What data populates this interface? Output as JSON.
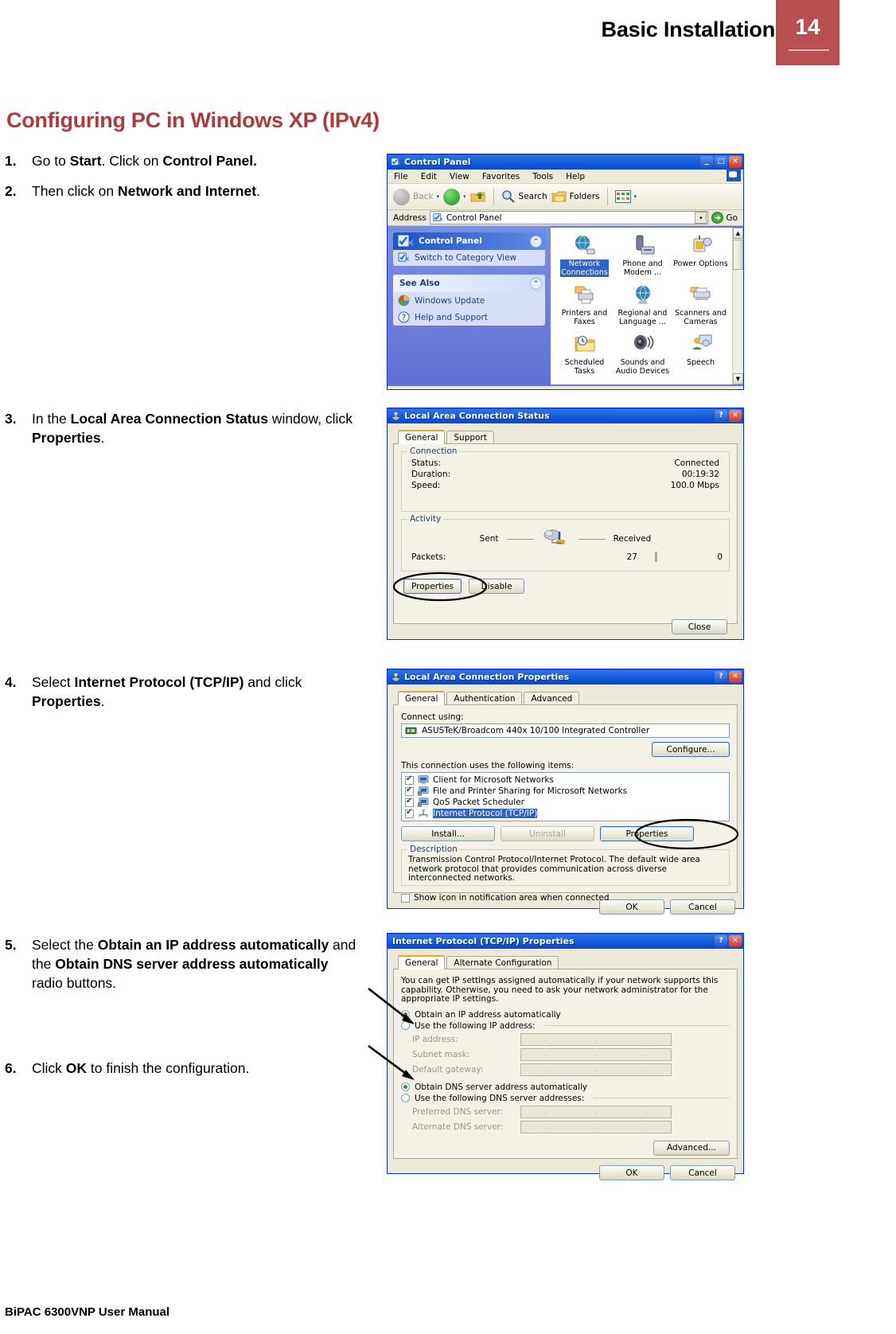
{
  "header": {
    "title": "Basic Installation",
    "page_number": "14",
    "accent_color": "#b8504f"
  },
  "section": {
    "heading": "Configuring PC in Windows XP (IPv4)",
    "heading_color": "#b03a3a"
  },
  "steps": [
    {
      "num": "1.",
      "html": "Go to <b>Start</b>. Click on <b>Control Panel.</b>"
    },
    {
      "num": "2.",
      "html": "Then click on <b>Network and Internet</b>."
    },
    {
      "num": "3.",
      "html": "In the <b>Local Area Connection Status</b> window, click <b>Properties</b>."
    },
    {
      "num": "4.",
      "html": "Select <b>Internet Protocol (TCP/IP)</b> and click <b>Properties</b>."
    },
    {
      "num": "5.",
      "html": "Select the <b>Obtain an IP address automatically</b> and the <b>Obtain DNS server address automatically</b> radio buttons."
    },
    {
      "num": "6.",
      "html": "Click <b>OK</b> to finish the configuration."
    }
  ],
  "footer": {
    "text": "BiPAC 6300VNP User Manual"
  },
  "control_panel": {
    "title": "Control Panel",
    "title_icon": "control-panel-icon",
    "window_buttons": {
      "minimize": "_",
      "maximize": "□",
      "close": "✕"
    },
    "menus": [
      "File",
      "Edit",
      "View",
      "Favorites",
      "Tools",
      "Help"
    ],
    "toolbar": {
      "back": "Back",
      "forward": "",
      "up": "",
      "search": "Search",
      "folders": "Folders",
      "views": ""
    },
    "address": {
      "label": "Address",
      "value": "Control Panel",
      "go": "Go"
    },
    "sidebar": {
      "panel1": {
        "title": "Control Panel",
        "items": [
          {
            "label": "Switch to Category View",
            "icon": "control-panel-icon"
          }
        ]
      },
      "panel2": {
        "title": "See Also",
        "items": [
          {
            "label": "Windows Update",
            "icon": "windows-update-icon"
          },
          {
            "label": "Help and Support",
            "icon": "help-icon"
          }
        ]
      }
    },
    "icons": [
      {
        "label": "Network\nConnections",
        "icon": "network-connections-icon",
        "selected": true
      },
      {
        "label": "Phone and\nModem ...",
        "icon": "phone-modem-icon",
        "selected": false
      },
      {
        "label": "Power Options",
        "icon": "power-options-icon",
        "selected": false
      },
      {
        "label": "Printers and\nFaxes",
        "icon": "printers-faxes-icon",
        "selected": false
      },
      {
        "label": "Regional and\nLanguage ...",
        "icon": "regional-language-icon",
        "selected": false
      },
      {
        "label": "Scanners and\nCameras",
        "icon": "scanners-cameras-icon",
        "selected": false
      },
      {
        "label": "Scheduled\nTasks",
        "icon": "scheduled-tasks-icon",
        "selected": false
      },
      {
        "label": "Sounds and\nAudio Devices",
        "icon": "sounds-audio-icon",
        "selected": false
      },
      {
        "label": "Speech",
        "icon": "speech-icon",
        "selected": false
      }
    ]
  },
  "lac_status": {
    "title": "Local Area Connection Status",
    "title_icon": "network-plug-icon",
    "window_buttons": {
      "help": "?",
      "close": "✕"
    },
    "tabs": [
      {
        "label": "General",
        "active": true
      },
      {
        "label": "Support",
        "active": false
      }
    ],
    "connection": {
      "legend": "Connection",
      "rows": [
        {
          "label": "Status:",
          "value": "Connected"
        },
        {
          "label": "Duration:",
          "value": "00:19:32"
        },
        {
          "label": "Speed:",
          "value": "100.0 Mbps"
        }
      ]
    },
    "activity": {
      "legend": "Activity",
      "sent_label": "Sent",
      "received_label": "Received",
      "packets_label": "Packets:",
      "packets_sent": "27",
      "packets_received": "0"
    },
    "buttons": {
      "properties": "Properties",
      "disable": "Disable",
      "close": "Close"
    },
    "annotation": "ellipse-around-properties"
  },
  "lac_properties": {
    "title": "Local Area Connection Properties",
    "title_icon": "network-plug-icon",
    "window_buttons": {
      "help": "?",
      "close": "✕"
    },
    "tabs": [
      {
        "label": "General",
        "active": true
      },
      {
        "label": "Authentication",
        "active": false
      },
      {
        "label": "Advanced",
        "active": false
      }
    ],
    "connect_using_label": "Connect using:",
    "adapter": "ASUSTeK/Broadcom 440x 10/100 Integrated Controller",
    "adapter_icon": "nic-card-icon",
    "configure_button": "Configure...",
    "items_label": "This connection uses the following items:",
    "items": [
      {
        "label": "Client for Microsoft Networks",
        "checked": true,
        "selected": false
      },
      {
        "label": "File and Printer Sharing for Microsoft Networks",
        "checked": true,
        "selected": false
      },
      {
        "label": "QoS Packet Scheduler",
        "checked": true,
        "selected": false
      },
      {
        "label": "Internet Protocol (TCP/IP)",
        "checked": true,
        "selected": true
      }
    ],
    "buttons": {
      "install": "Install...",
      "uninstall": "Uninstall",
      "properties": "Properties",
      "ok": "OK",
      "cancel": "Cancel"
    },
    "description": {
      "legend": "Description",
      "text": "Transmission Control Protocol/Internet Protocol. The default wide area network protocol that provides communication across diverse interconnected networks."
    },
    "show_icon_checkbox": {
      "label": "Show icon in notification area when connected",
      "checked": false
    },
    "annotation": "ellipse-around-properties"
  },
  "tcpip_properties": {
    "title": "Internet Protocol (TCP/IP) Properties",
    "window_buttons": {
      "help": "?",
      "close": "✕"
    },
    "tabs": [
      {
        "label": "General",
        "active": true
      },
      {
        "label": "Alternate Configuration",
        "active": false
      }
    ],
    "intro": "You can get IP settings assigned automatically if your network supports this capability. Otherwise, you need to ask your network administrator for the appropriate IP settings.",
    "ip_options": [
      {
        "label": "Obtain an IP address automatically",
        "selected": true
      },
      {
        "label": "Use the following IP address:",
        "selected": false
      }
    ],
    "ip_fields": [
      {
        "label": "IP address:",
        "value": ""
      },
      {
        "label": "Subnet mask:",
        "value": ""
      },
      {
        "label": "Default gateway:",
        "value": ""
      }
    ],
    "dns_options": [
      {
        "label": "Obtain DNS server address automatically",
        "selected": true
      },
      {
        "label": "Use the following DNS server addresses:",
        "selected": false
      }
    ],
    "dns_fields": [
      {
        "label": "Preferred DNS server:",
        "value": ""
      },
      {
        "label": "Alternate DNS server:",
        "value": ""
      }
    ],
    "buttons": {
      "advanced": "Advanced...",
      "ok": "OK",
      "cancel": "Cancel"
    },
    "annotation": "arrows-pointing-to-radio-buttons"
  }
}
